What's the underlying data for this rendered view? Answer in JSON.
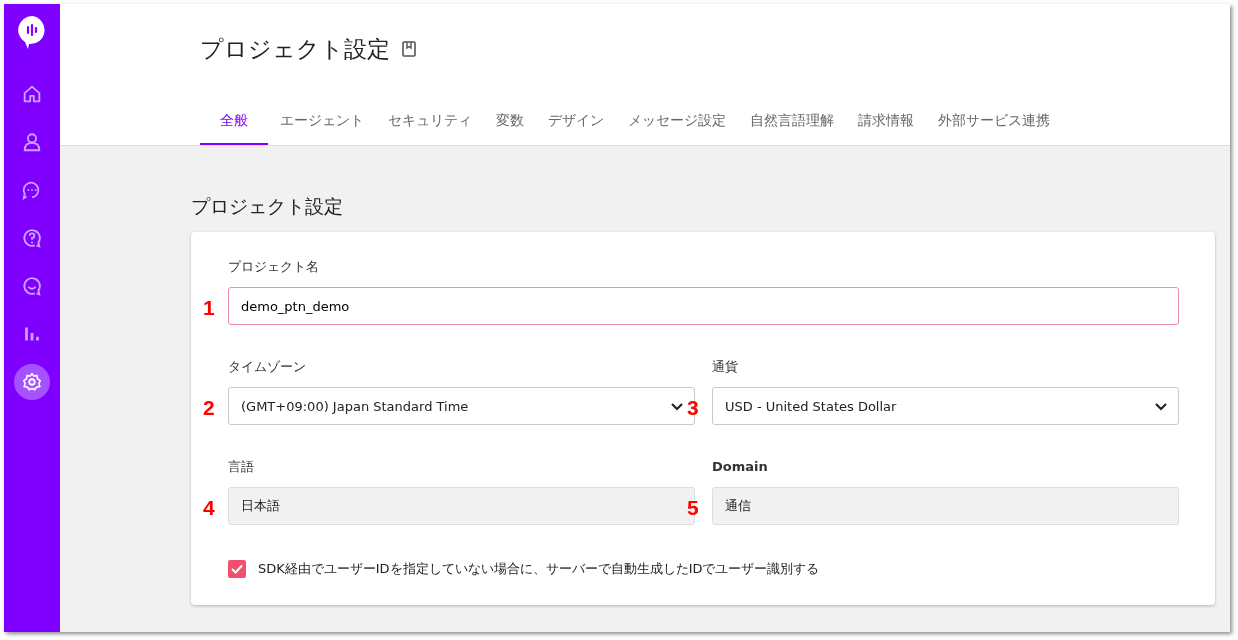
{
  "sidebar": {
    "items": [
      {
        "kind": "home",
        "selected": false
      },
      {
        "kind": "user",
        "selected": false
      },
      {
        "kind": "chat",
        "selected": false
      },
      {
        "kind": "help",
        "selected": false
      },
      {
        "kind": "smile",
        "selected": false
      },
      {
        "kind": "chart",
        "selected": false
      },
      {
        "kind": "gear",
        "selected": true
      }
    ]
  },
  "header": {
    "title": "プロジェクト設定",
    "tabs": [
      {
        "label": "全般",
        "selected": true
      },
      {
        "label": "エージェント",
        "selected": false
      },
      {
        "label": "セキュリティ",
        "selected": false
      },
      {
        "label": "変数",
        "selected": false
      },
      {
        "label": "デザイン",
        "selected": false
      },
      {
        "label": "メッセージ設定",
        "selected": false
      },
      {
        "label": "自然言語理解",
        "selected": false
      },
      {
        "label": "請求情報",
        "selected": false
      },
      {
        "label": "外部サービス連携",
        "selected": false
      }
    ]
  },
  "section": {
    "title": "プロジェクト設定",
    "fields": [
      {
        "kind": "text",
        "label": "プロジェクト名",
        "value": "demo_ptn_demo",
        "marker": "1"
      },
      {
        "kind": "select",
        "label": "タイムゾーン",
        "value": "(GMT+09:00) Japan Standard Time",
        "marker": "2"
      },
      {
        "kind": "select",
        "label": "通貨",
        "value": "USD - United States Dollar",
        "marker": "3"
      },
      {
        "kind": "readonly",
        "label": "言語",
        "value": "日本語",
        "marker": "4"
      },
      {
        "kind": "readonly",
        "label": "Domain",
        "value": "通信",
        "marker": "5",
        "bold": true
      }
    ],
    "checkbox": {
      "label": "SDK経由でユーザーIDを指定していない場合に、サーバーで自動生成したIDでユーザー識別する",
      "checked": true
    }
  }
}
